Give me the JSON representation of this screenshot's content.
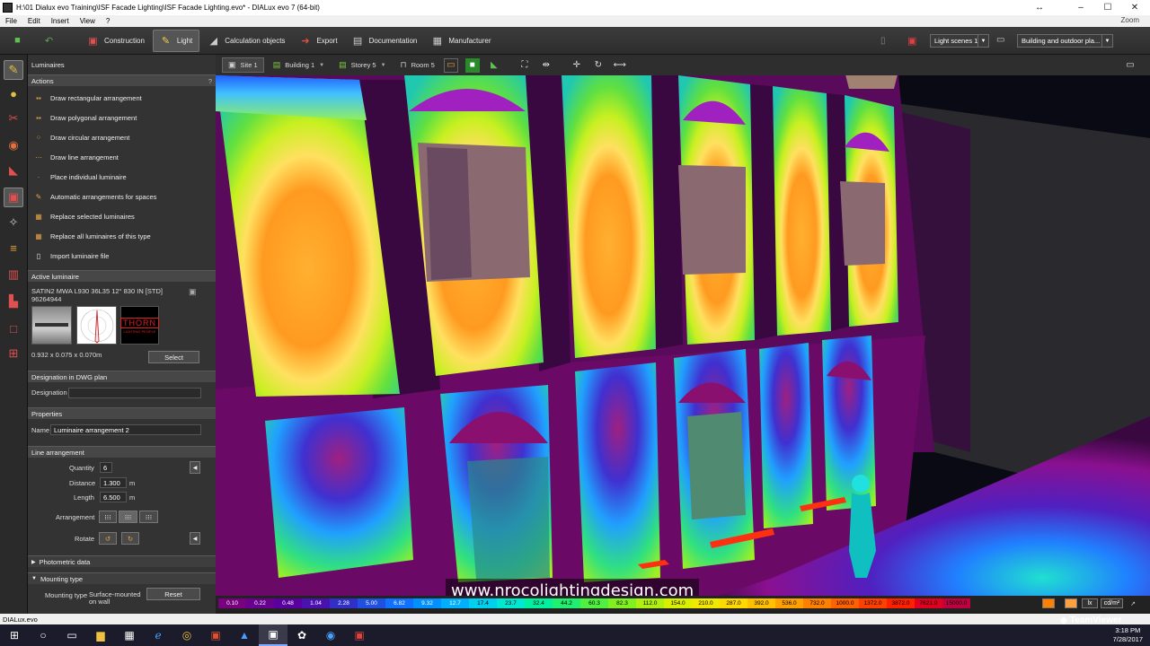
{
  "window": {
    "title": "H:\\01 Dialux evo Training\\ISF Facade Lighting\\ISF Facade Lighting.evo* - DIALux evo 7  (64-bit)",
    "minimize": "–",
    "maximize": "☐",
    "close": "✕",
    "restore": "↔"
  },
  "menu": {
    "items": [
      "File",
      "Edit",
      "Insert",
      "View",
      "?"
    ],
    "zoom": "Zoom"
  },
  "toolbar": {
    "buttons": [
      {
        "label": "Construction"
      },
      {
        "label": "Light"
      },
      {
        "label": "Calculation objects"
      },
      {
        "label": "Export"
      },
      {
        "label": "Documentation"
      },
      {
        "label": "Manufacturer"
      }
    ],
    "light_scene": "Light scenes 1",
    "view_mode": "Building and outdoor pla..."
  },
  "panel": {
    "header": "Luminaires",
    "actions_title": "Actions",
    "help": "?",
    "actions": [
      "Draw rectangular arrangement",
      "Draw polygonal arrangement",
      "Draw circular arrangement",
      "Draw line arrangement",
      "Place individual luminaire",
      "Automatic arrangements for spaces",
      "Replace selected luminaires",
      "Replace all luminaires of this type",
      "Import luminaire file"
    ],
    "active_title": "Active luminaire",
    "luminaire_name": "SATIN2 MWA L930 36L35 12° 830 IN [STD]",
    "luminaire_code": "96264944",
    "brand": "THORN",
    "brand_sub": "LIGHTING PEOPLE",
    "dimensions": "0.932 x 0.075 x 0.070m",
    "select_button": "Select",
    "dwg_title": "Designation in DWG plan",
    "designation_label": "Designation",
    "designation_value": "",
    "properties_title": "Properties",
    "name_label": "Name",
    "name_value": "Luminaire arrangement 2",
    "line_title": "Line arrangement",
    "quantity_label": "Quantity",
    "quantity_value": "6",
    "distance_label": "Distance",
    "distance_value": "1.300",
    "length_label": "Length",
    "length_value": "6.500",
    "unit_m": "m",
    "arrangement_label": "Arrangement",
    "rotate_label": "Rotate",
    "photometric_title": "Photometric data",
    "mounting_title": "Mounting type",
    "mounting_label": "Mounting type",
    "mounting_value": "Surface-mounted on wall",
    "reset_button": "Reset"
  },
  "view_tabs": [
    "Site 1",
    "Building 1",
    "Storey 5",
    "Room 5"
  ],
  "legend": {
    "values": [
      "0.10",
      "0.22",
      "0.48",
      "1.04",
      "2.28",
      "5.00",
      "6.82",
      "9.32",
      "12.7",
      "17.4",
      "23.7",
      "32.4",
      "44.2",
      "60.3",
      "82.3",
      "112.0",
      "154.0",
      "210.0",
      "287.0",
      "392.0",
      "536.0",
      "732.0",
      "1000.0",
      "1372.0",
      "3872.0",
      "7621.0",
      "15000.0"
    ],
    "colors": [
      "#7a0080",
      "#6a0090",
      "#5a00a0",
      "#4a10b0",
      "#3030c8",
      "#2050e0",
      "#1070ff",
      "#0090ff",
      "#00b0ff",
      "#00d0f0",
      "#00e8d0",
      "#00f0a0",
      "#20f070",
      "#50f040",
      "#80f020",
      "#b0f010",
      "#d8f000",
      "#f0e800",
      "#ffd800",
      "#ffc000",
      "#ffa000",
      "#ff8000",
      "#ff6000",
      "#ff4000",
      "#ff2000",
      "#e00020",
      "#c00040"
    ],
    "unit_lx": "lx",
    "unit_cd": "cd/m²"
  },
  "watermark": "www.nrocolightingdesign.com",
  "status": "DIALux.evo",
  "teamviewer": "TeamViewer",
  "clock": {
    "time": "3:18 PM",
    "date": "7/28/2017"
  }
}
